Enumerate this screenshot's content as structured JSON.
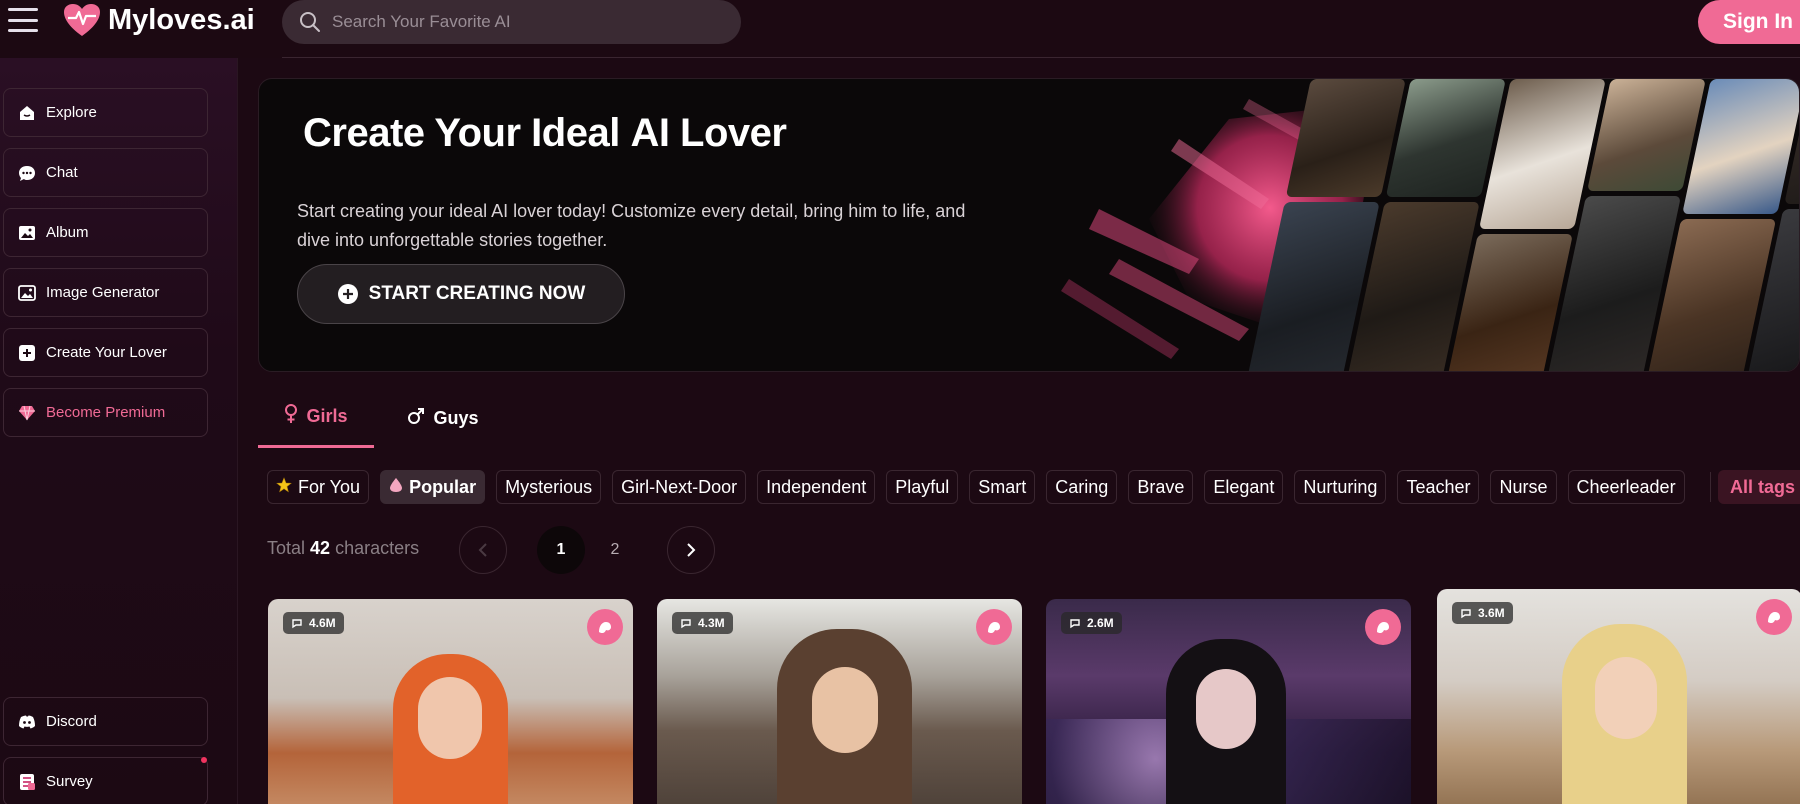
{
  "header": {
    "logo_text": "Myloves.ai",
    "search_placeholder": "Search Your Favorite AI",
    "signin_label": "Sign In"
  },
  "sidebar": {
    "items": [
      {
        "label": "Explore",
        "icon": "home-icon"
      },
      {
        "label": "Chat",
        "icon": "chat-icon"
      },
      {
        "label": "Album",
        "icon": "image-icon"
      },
      {
        "label": "Image Generator",
        "icon": "image-generator-icon"
      },
      {
        "label": "Create Your Lover",
        "icon": "plus-square-icon"
      },
      {
        "label": "Become Premium",
        "icon": "diamond-icon"
      }
    ],
    "bottom_items": [
      {
        "label": "Discord",
        "icon": "discord-icon"
      },
      {
        "label": "Survey",
        "icon": "survey-icon"
      }
    ]
  },
  "hero": {
    "title_main": "Create Your Ideal ",
    "title_highlight": "AI Lover",
    "subtitle": "Start creating your ideal AI lover today! Customize every detail, bring him to life, and dive into unforgettable stories together.",
    "cta_label": "START CREATING NOW"
  },
  "tabs": [
    {
      "label": "Girls",
      "icon": "female-icon",
      "active": true
    },
    {
      "label": "Guys",
      "icon": "male-icon",
      "active": false
    }
  ],
  "tags": [
    {
      "label": "For You",
      "icon": "star-icon",
      "active": false
    },
    {
      "label": "Popular",
      "icon": "drop-icon",
      "active": true
    },
    {
      "label": "Mysterious"
    },
    {
      "label": "Girl-Next-Door"
    },
    {
      "label": "Independent"
    },
    {
      "label": "Playful"
    },
    {
      "label": "Smart"
    },
    {
      "label": "Caring"
    },
    {
      "label": "Brave"
    },
    {
      "label": "Elegant"
    },
    {
      "label": "Nurturing"
    },
    {
      "label": "Teacher"
    },
    {
      "label": "Nurse"
    },
    {
      "label": "Cheerleader"
    }
  ],
  "all_tags_label": "All tags",
  "results": {
    "total_prefix": "Total ",
    "total_count": "42",
    "total_suffix": " characters"
  },
  "pagination": {
    "pages": [
      "1",
      "2"
    ],
    "current": "1"
  },
  "cards": [
    {
      "count": "4.6M"
    },
    {
      "count": "4.3M"
    },
    {
      "count": "2.6M"
    },
    {
      "count": "3.6M"
    }
  ],
  "colors": {
    "accent": "#f06a95",
    "background": "#1c0913"
  }
}
